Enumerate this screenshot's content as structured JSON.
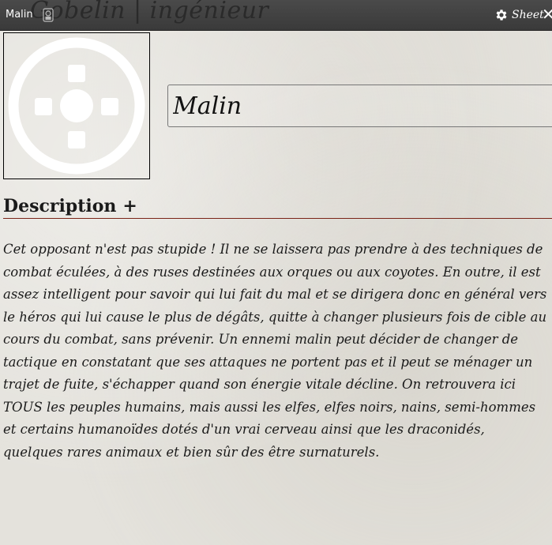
{
  "window": {
    "background_title": "Gobelin | ingénieur",
    "title": "Malin",
    "token_icon": "token-icon",
    "sheet_label": "Sheet",
    "sheet_icon": "gear-icon",
    "close_label": "✕"
  },
  "portrait": {
    "icon": "placeholder-portrait-icon"
  },
  "name_field": {
    "value": "Malin"
  },
  "description": {
    "title": "Description",
    "toggle": "+",
    "text": "Cet opposant n'est pas stupide ! Il ne se laissera pas prendre à des techniques de combat éculées, à des ruses destinées aux orques ou aux coyotes. En outre, il est assez intelligent pour savoir qui lui fait du mal et se dirigera donc en général vers le héros qui lui cause le plus de dégâts, quitte à changer plusieurs fois de cible au cours du combat, sans prévenir. Un ennemi malin peut décider de changer de tactique en constatant que ses attaques ne portent pas et il peut se ménager un trajet de fuite, s'échapper quand son énergie vitale décline. On retrouvera ici TOUS les peuples humains, mais aussi les elfes, elfes noirs, nains, semi-hommes et certains humanoïdes dotés d'un vrai cerveau ainsi que les draconidés, quelques rares animaux et bien sûr des être surnaturels."
  },
  "colors": {
    "titlebar": "#3a3a3a",
    "divider": "#7a2418",
    "parchment": "#e4e2dc"
  }
}
